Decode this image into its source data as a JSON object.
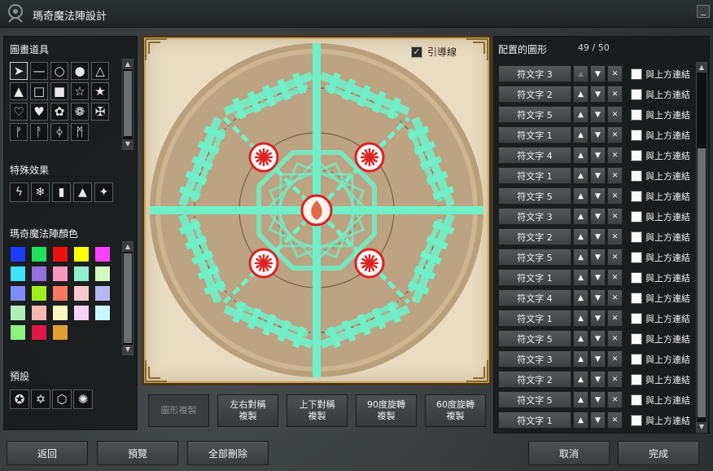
{
  "window": {
    "title": "瑪奇魔法陣設計",
    "minimize": "_"
  },
  "tools": {
    "label": "圖畫道具",
    "items": [
      {
        "name": "pointer-icon",
        "glyph": "➤"
      },
      {
        "name": "line-icon",
        "glyph": "—"
      },
      {
        "name": "circle-outline-icon",
        "glyph": "○"
      },
      {
        "name": "circle-filled-icon",
        "glyph": "●"
      },
      {
        "name": "triangle-outline-icon",
        "glyph": "△"
      },
      {
        "name": "triangle-filled-icon",
        "glyph": "▲"
      },
      {
        "name": "square-outline-icon",
        "glyph": "□"
      },
      {
        "name": "square-filled-icon",
        "glyph": "■"
      },
      {
        "name": "star-outline-icon",
        "glyph": "☆"
      },
      {
        "name": "star-filled-icon",
        "glyph": "★"
      },
      {
        "name": "heart-outline-icon",
        "glyph": "♡"
      },
      {
        "name": "heart-filled-icon",
        "glyph": "♥"
      },
      {
        "name": "knot-icon",
        "glyph": "✿"
      },
      {
        "name": "flower-knot-icon",
        "glyph": "❁"
      },
      {
        "name": "diamond-rune-icon",
        "glyph": "✠"
      },
      {
        "name": "rune-fehu-icon",
        "glyph": "ᚠ"
      },
      {
        "name": "rune-ansuz-icon",
        "glyph": "ᚨ"
      },
      {
        "name": "rune-thurs-icon",
        "glyph": "ᛄ"
      },
      {
        "name": "rune-mannaz-icon",
        "glyph": "ᛗ"
      }
    ]
  },
  "effects": {
    "label": "特殊效果",
    "items": [
      {
        "name": "lightning-icon",
        "glyph": "ϟ"
      },
      {
        "name": "snowflake-icon",
        "glyph": "❄"
      },
      {
        "name": "flame-icon",
        "glyph": "▮"
      },
      {
        "name": "fire-icon",
        "glyph": "▲"
      },
      {
        "name": "sparkle-icon",
        "glyph": "✦"
      }
    ]
  },
  "colors": {
    "label": "瑪奇魔法陣顏色",
    "swatches": [
      "#1b3cff",
      "#20e060",
      "#ee1010",
      "#ffff00",
      "#ff40ff",
      "#40e0ff",
      "#9470e0",
      "#f898c0",
      "#90f0d0",
      "#d0f8c0",
      "#7c8cf8",
      "#a0f020",
      "#f87860",
      "#f8c8d0",
      "#b8b8f0",
      "#b0f0b8",
      "#f8b8b0",
      "#f8f8c0",
      "#f8d0f8",
      "#c8f8ff",
      "#90f080",
      "#e01848",
      "#e0a030"
    ]
  },
  "presets": {
    "label": "預設",
    "items": [
      {
        "name": "preset-pentagram-icon",
        "glyph": "✪"
      },
      {
        "name": "preset-star-circle-icon",
        "glyph": "✡"
      },
      {
        "name": "preset-hexagon-icon",
        "glyph": "⬡"
      },
      {
        "name": "preset-ring-icon",
        "glyph": "✺"
      }
    ]
  },
  "canvas": {
    "guide_label": "引導線",
    "guide_checked": "✓"
  },
  "actions": {
    "copy": "圖形複製",
    "mirror_lr": "左右對稱\n複製",
    "mirror_ud": "上下對稱\n複製",
    "rotate90": "90度旋轉\n複製",
    "rotate60": "60度旋轉\n複製"
  },
  "bottom": {
    "back": "返回",
    "preview": "預覽",
    "clear": "全部刪除",
    "cancel": "取消",
    "done": "完成"
  },
  "placed": {
    "label": "配置的圖形",
    "count": "49 / 50",
    "link_label": "與上方連結",
    "rows": [
      "符文字 3",
      "符文字 2",
      "符文字 5",
      "符文字 1",
      "符文字 4",
      "符文字 1",
      "符文字 5",
      "符文字 3",
      "符文字 2",
      "符文字 5",
      "符文字 1",
      "符文字 4",
      "符文字 1",
      "符文字 5",
      "符文字 3",
      "符文字 2",
      "符文字 5",
      "符文字 1"
    ]
  },
  "palette": {
    "accent": "#6ff0c8",
    "seal": "#e02020"
  }
}
